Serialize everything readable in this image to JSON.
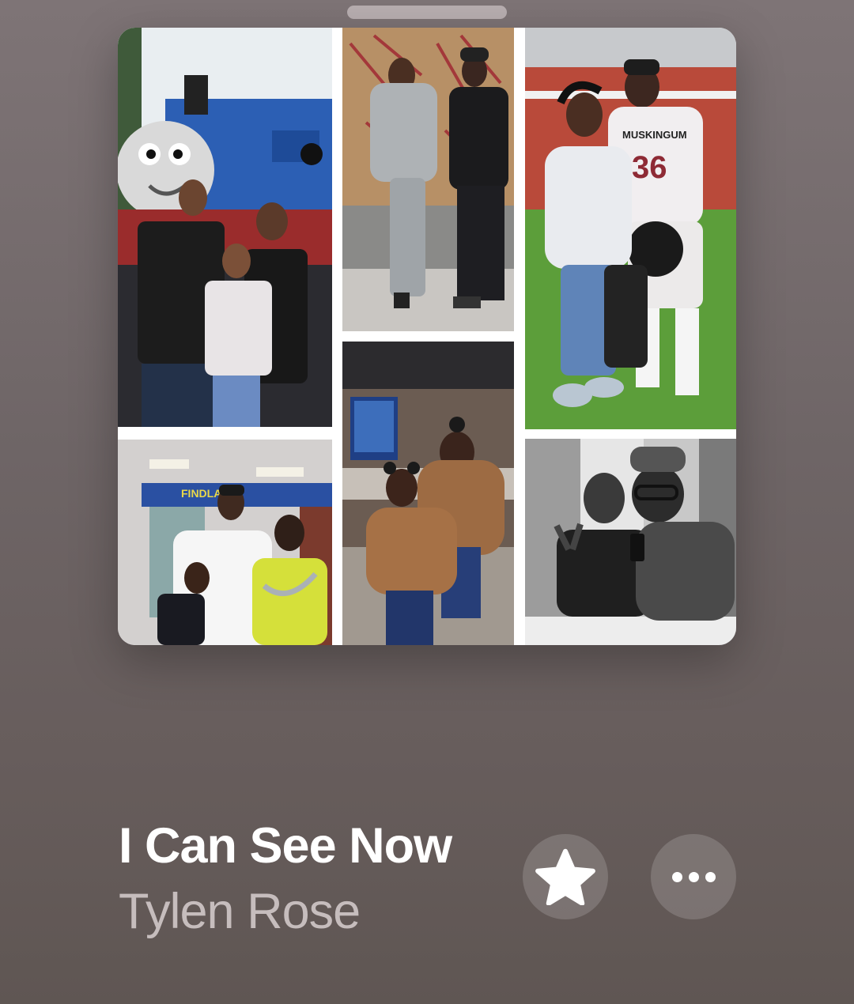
{
  "now_playing": {
    "title": "I Can See Now",
    "artist": "Tylen Rose",
    "favorite_icon": "star-icon",
    "more_icon": "ellipsis-icon"
  },
  "artwork": {
    "description_tiles": 6,
    "jersey_text": "MUSKINGUM",
    "jersey_number": "36",
    "store_sign": "FINDLA"
  },
  "colors": {
    "title": "#ffffff",
    "artist": "#c6bdbd",
    "background": "#6e6566"
  }
}
